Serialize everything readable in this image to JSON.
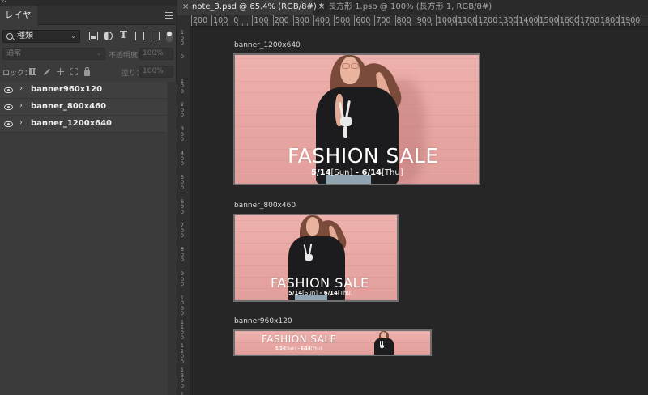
{
  "panel": {
    "tab_label": "レイヤー",
    "collapse_glyph": "‹‹",
    "filter_kind": "種類",
    "blend_mode": "通常",
    "opacity_label": "不透明度：",
    "opacity_value": "100%",
    "lock_label": "ロック：",
    "fill_label": "塗り：",
    "fill_value": "100%",
    "layers": [
      {
        "name": "banner960x120"
      },
      {
        "name": "banner_800x460"
      },
      {
        "name": "banner_1200x640"
      }
    ]
  },
  "doc_tabs": [
    {
      "label": "note_3.psd @ 65.4% (RGB/8#) *",
      "active": true
    },
    {
      "label": "長方形 1.psb @ 100% (長方形 1, RGB/8#)",
      "active": false
    }
  ],
  "ruler": {
    "top_labels": [
      "200",
      "100",
      "0",
      "100",
      "200",
      "300",
      "400",
      "500",
      "600",
      "700",
      "800",
      "900",
      "1000",
      "1100",
      "1200",
      "1300",
      "1400",
      "1500",
      "1600",
      "1700",
      "1800",
      "1900"
    ],
    "left_labels": [
      "100",
      "0",
      "100",
      "200",
      "300",
      "400",
      "500",
      "600",
      "700",
      "800",
      "900",
      "1000",
      "1100",
      "1200",
      "1300",
      "1400"
    ]
  },
  "artboards": [
    {
      "label": "banner_1200x640",
      "headline": "FASHION SALE",
      "date_a": "5/14",
      "day_a": "[Sun]",
      "sep": " - ",
      "date_b": "6/14",
      "day_b": "[Thu]"
    },
    {
      "label": "banner_800x460",
      "headline": "FASHION SALE",
      "date_a": "5/14",
      "day_a": "[Sun]",
      "sep": " - ",
      "date_b": "6/14",
      "day_b": "[Thu]"
    },
    {
      "label": "banner960x120",
      "headline": "FASHION SALE",
      "date_a": "5/14",
      "day_a": "[Sun]",
      "sep": " - ",
      "date_b": "6/14",
      "day_b": "[Thu]"
    }
  ],
  "colors": {
    "panel_bg": "#3b3b3b",
    "canvas_bg": "#262626",
    "banner_pink": "#e9a9a4",
    "shirt": "#1c1c1e"
  },
  "icons": [
    "search-icon",
    "pixel-layer-icon",
    "adjustment-layer-icon",
    "type-layer-icon",
    "shape-layer-icon",
    "smart-object-icon",
    "eye-icon",
    "chevron-right-icon",
    "close-icon",
    "panel-menu-icon"
  ]
}
